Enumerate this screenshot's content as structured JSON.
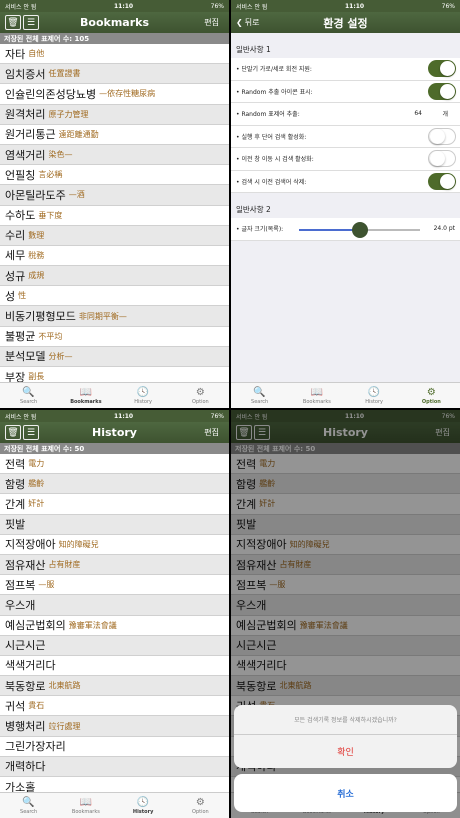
{
  "status": {
    "carrier": "서비스 안 됨",
    "time": "11:10",
    "battery": "76%"
  },
  "bookmarks": {
    "title": "Bookmarks",
    "edit": "편집",
    "count": "저장된 전체 표제어 수: 105",
    "rows": [
      {
        "w": "자타",
        "h": "自他"
      },
      {
        "w": "임치증서",
        "h": "任置證書"
      },
      {
        "w": "인슐린의존성당뇨병",
        "h": "—依存性糖尿病"
      },
      {
        "w": "원격처리",
        "h": "原子力管理"
      },
      {
        "w": "원거리통근",
        "h": "遠距離通勤"
      },
      {
        "w": "염색거리",
        "h": "染色—"
      },
      {
        "w": "언필칭",
        "h": "言必稱"
      },
      {
        "w": "아몬틸라도주",
        "h": "—酒"
      },
      {
        "w": "수하도",
        "h": "垂下度"
      },
      {
        "w": "수리",
        "h": "數理"
      },
      {
        "w": "세무",
        "h": "稅務"
      },
      {
        "w": "성규",
        "h": "成規"
      },
      {
        "w": "성",
        "h": "性"
      },
      {
        "w": "비동기평형모드",
        "h": "非同期平衡—"
      },
      {
        "w": "불평균",
        "h": "不平均"
      },
      {
        "w": "분석모델",
        "h": "分析—"
      },
      {
        "w": "부장",
        "h": "副長"
      }
    ]
  },
  "settings": {
    "back": "뒤로",
    "title": "환경 설정",
    "section1": "일반사항 1",
    "rows": [
      {
        "label": "• 단말기 가로/세로 회전 지원:",
        "on": true
      },
      {
        "label": "• Random 추출 아이콘 표시:",
        "on": true
      },
      {
        "label": "• Random 표제어 추출:",
        "value": "64",
        "unit": "개"
      },
      {
        "label": "• 실행 후 단어 검색 활성화:",
        "on": false
      },
      {
        "label": "• 이전 창 이동 시 검색 활성화:",
        "on": false
      },
      {
        "label": "• 검색 시 이전 검색어 삭제:",
        "on": true
      }
    ],
    "section2": "일반사항 2",
    "fontLabel": "• 글자 크기(목록):",
    "fontValue": "24.0 pt",
    "fontLevel": 0.5
  },
  "history": {
    "title": "History",
    "edit": "편집",
    "count": "저장된 전체 표제어 수: 50",
    "rows": [
      {
        "w": "전력",
        "h": "電力"
      },
      {
        "w": "함령",
        "h": "艦齡"
      },
      {
        "w": "간계",
        "h": "奸計"
      },
      {
        "w": "핏발",
        "h": ""
      },
      {
        "w": "지적장애아",
        "h": "知的障礙兒"
      },
      {
        "w": "점유재산",
        "h": "占有財産"
      },
      {
        "w": "점프복",
        "h": "—服"
      },
      {
        "w": "우스개",
        "h": ""
      },
      {
        "w": "예심군법회의",
        "h": "豫審軍法會議"
      },
      {
        "w": "시근시근",
        "h": ""
      },
      {
        "w": "색색거리다",
        "h": ""
      },
      {
        "w": "북동항로",
        "h": "北東航路"
      },
      {
        "w": "귀석",
        "h": "貴石"
      },
      {
        "w": "병행처리",
        "h": "竝行處理"
      },
      {
        "w": "그린가장자리",
        "h": ""
      },
      {
        "w": "개력하다",
        "h": ""
      },
      {
        "w": "가소홀",
        "h": ""
      }
    ]
  },
  "dialog": {
    "message": "모든 검색기록 정보를 삭제하시겠습니까?",
    "confirm": "확인",
    "cancel": "취소"
  },
  "tabs": [
    {
      "label": "Search",
      "icon": "search-icon"
    },
    {
      "label": "Bookmarks",
      "icon": "book-icon"
    },
    {
      "label": "History",
      "icon": "clock-icon"
    },
    {
      "label": "Option",
      "icon": "gear-icon"
    }
  ],
  "colors": {
    "navGreen": "#4e6840",
    "accentGreen": "#4e6b2a",
    "hanjaBrown": "#a06a20",
    "destructiveRed": "#e0302c"
  }
}
